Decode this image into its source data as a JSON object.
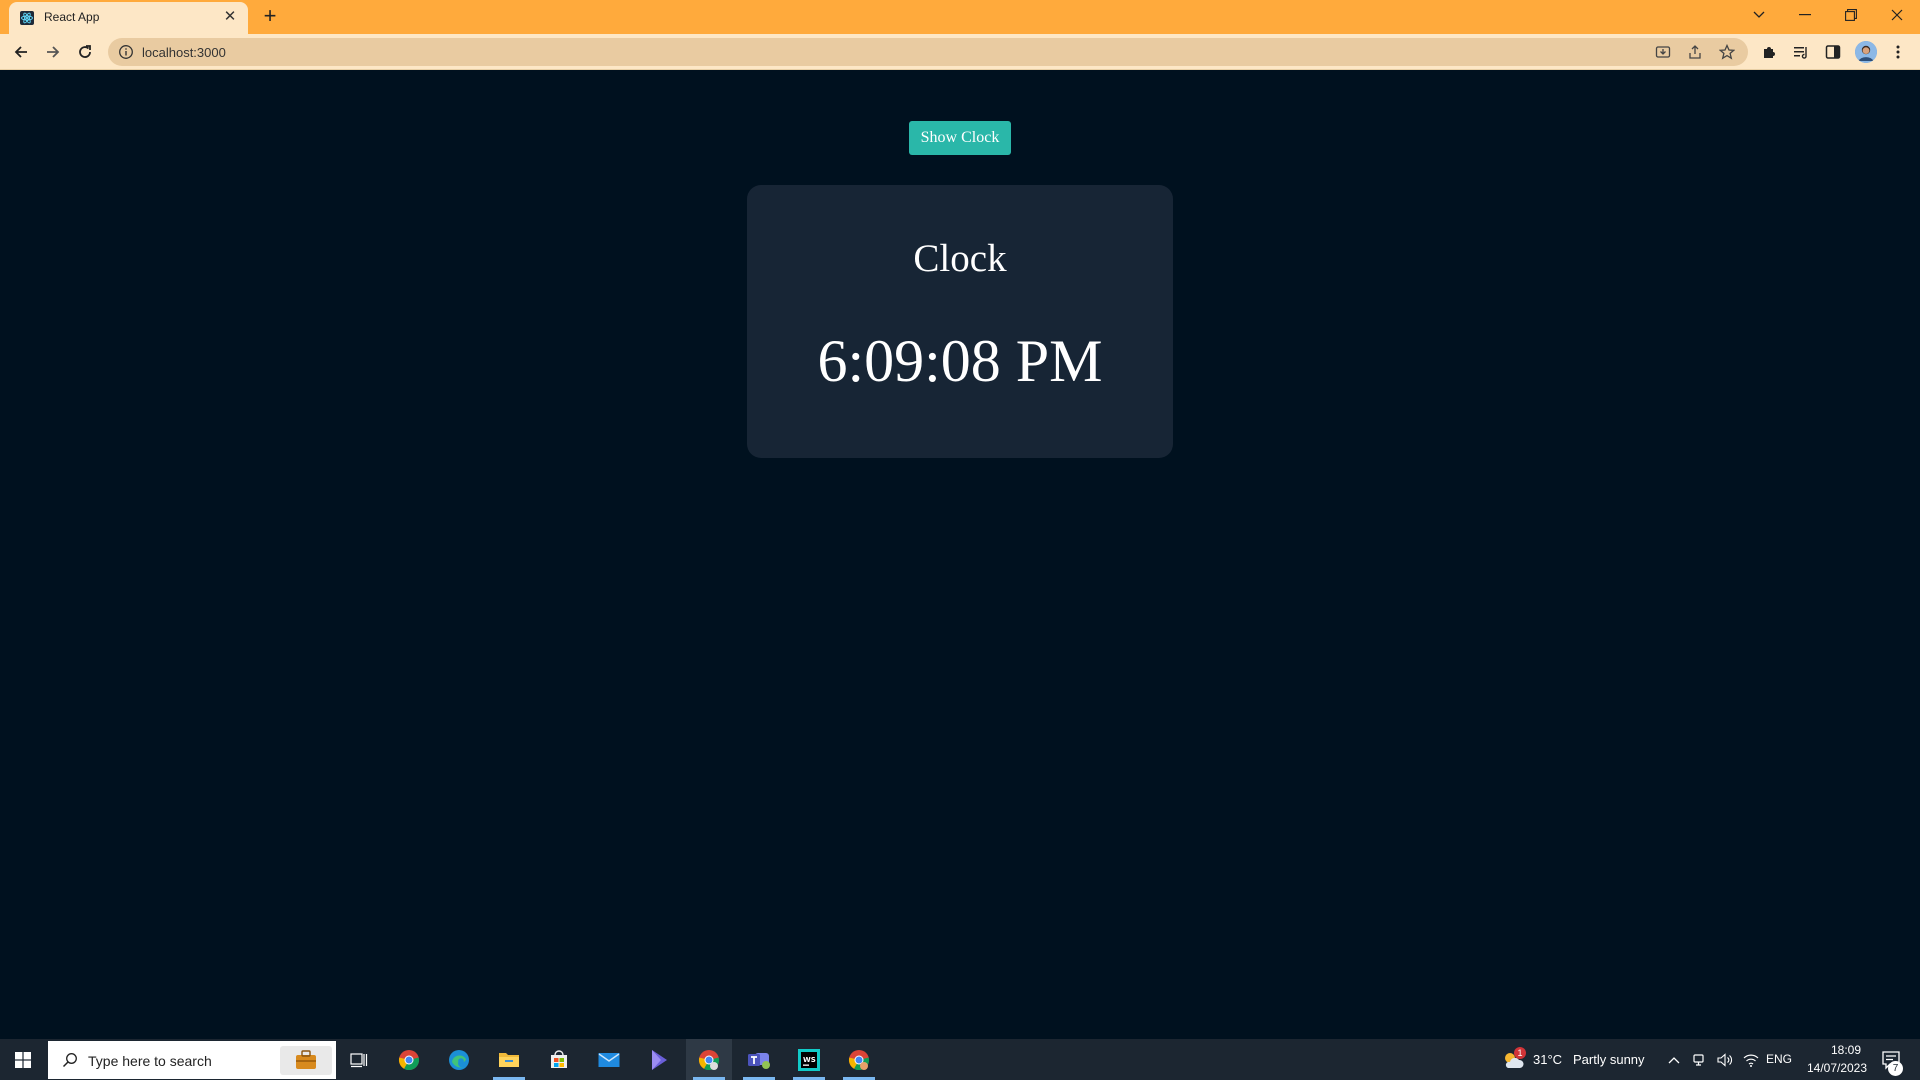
{
  "browser": {
    "tab": {
      "title": "React App"
    },
    "address": {
      "url": "localhost:3000"
    }
  },
  "page": {
    "button_label": "Show Clock",
    "clock_title": "Clock",
    "clock_time": "6:09:08 PM"
  },
  "taskbar": {
    "search_placeholder": "Type here to search",
    "weather": {
      "temp": "31°C",
      "condition": "Partly sunny",
      "badge": "1"
    },
    "lang": "ENG",
    "time": "18:09",
    "date": "14/07/2023",
    "notification_count": "7"
  },
  "colors": {
    "title_bar": "#ffaa3c",
    "toolbar": "#fde7c6",
    "page_bg": "#00111f",
    "card_bg": "#172535",
    "button_bg": "#2ab7a9",
    "taskbar_bg": "#1c2631"
  }
}
